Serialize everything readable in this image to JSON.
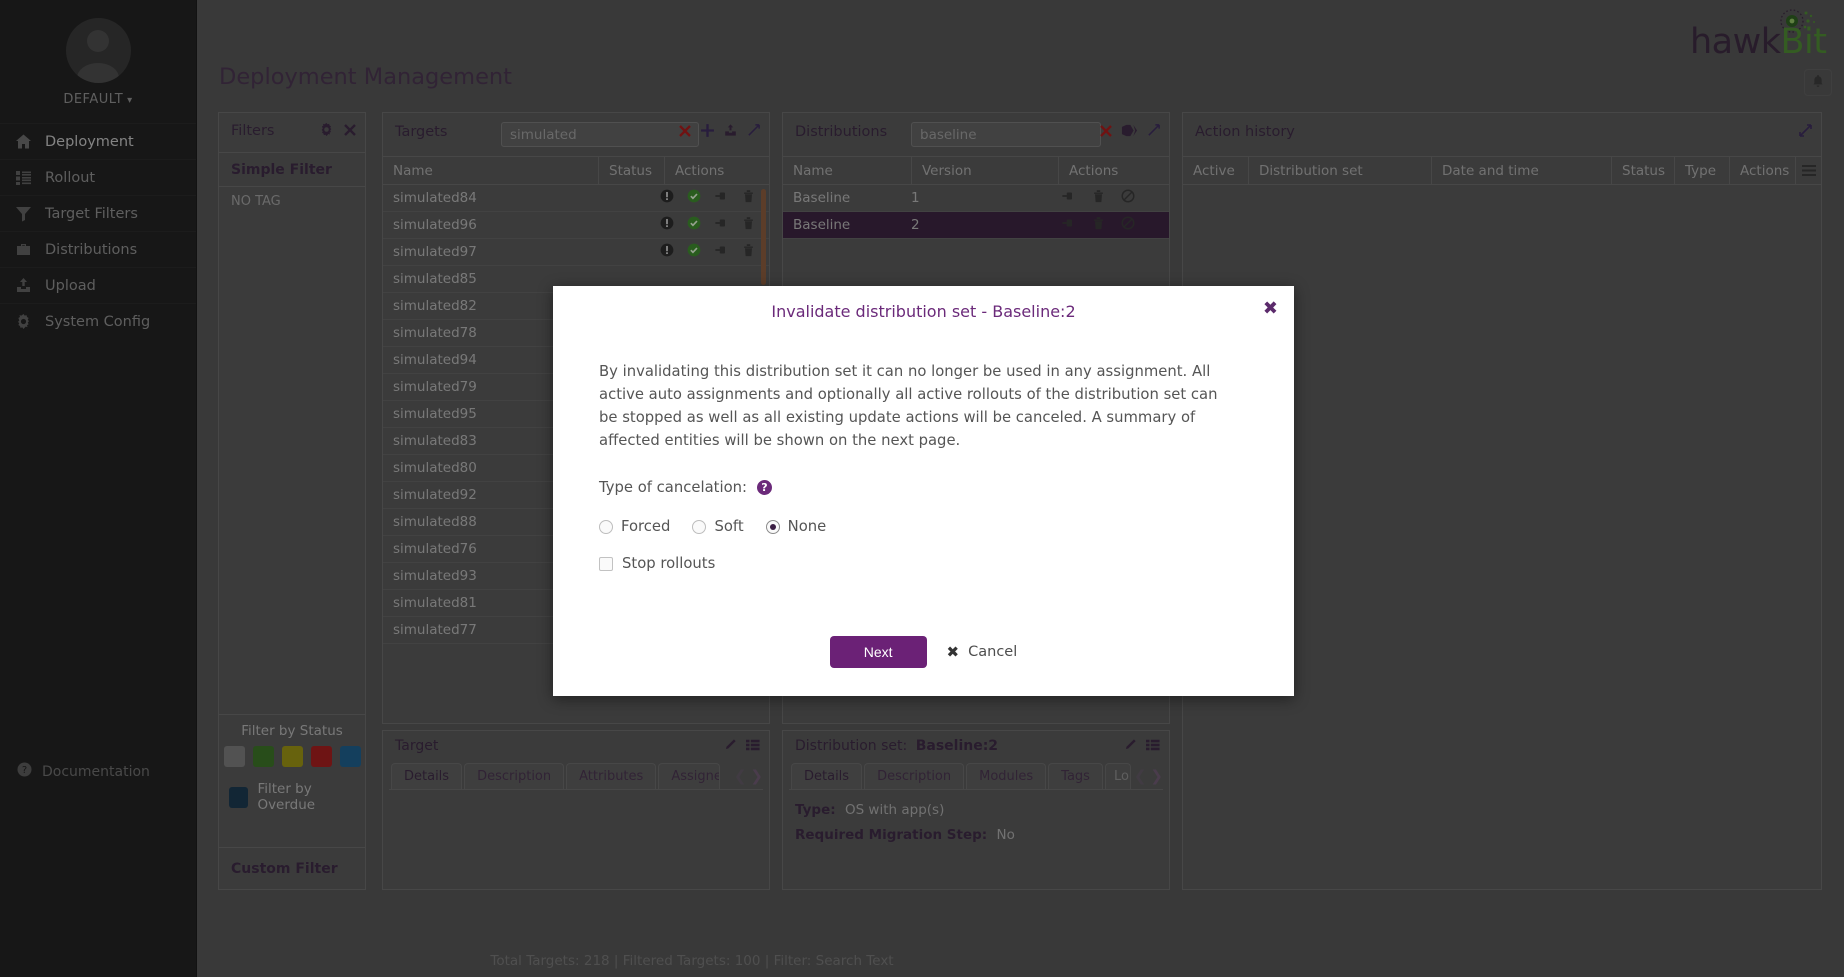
{
  "brand": {
    "name_part1": "hawk",
    "name_part2": "Bit",
    "color1": "#3d2a40",
    "color2": "#4e8a34"
  },
  "sidebar": {
    "tenant": "DEFAULT",
    "tenant_caret": "⌄",
    "items": [
      {
        "label": "Deployment",
        "icon": "home-icon",
        "active": true
      },
      {
        "label": "Rollout",
        "icon": "list-icon",
        "active": false
      },
      {
        "label": "Target Filters",
        "icon": "funnel-icon",
        "active": false
      },
      {
        "label": "Distributions",
        "icon": "briefcase-icon",
        "active": false
      },
      {
        "label": "Upload",
        "icon": "upload-icon",
        "active": false
      },
      {
        "label": "System Config",
        "icon": "gear-icon",
        "active": false
      }
    ],
    "documentation": "Documentation"
  },
  "header": {
    "title": "Deployment Management",
    "bell_icon": "bell-icon"
  },
  "filters_panel": {
    "title": "Filters",
    "gear_icon": "gear-icon",
    "close_icon": "close-icon",
    "simple_filter_label": "Simple Filter",
    "no_tag_label": "NO TAG",
    "filter_by_status_label": "Filter by Status",
    "status_colors": [
      "#7b7b7b",
      "#3c7328",
      "#9a9314",
      "#a41f1f",
      "#1f5f8b"
    ],
    "filter_by_overdue_label": "Filter by Overdue",
    "overdue_color": "#1b3a4f",
    "custom_filter_label": "Custom Filter"
  },
  "targets_panel": {
    "title": "Targets",
    "search_value": "simulated",
    "icons": [
      "close-icon",
      "plus-icon",
      "upload-icon",
      "maximize-icon"
    ],
    "columns": [
      "Name",
      "Status",
      "Actions"
    ],
    "rows": [
      {
        "name": "simulated84",
        "has_actions": true
      },
      {
        "name": "simulated96",
        "has_actions": true
      },
      {
        "name": "simulated97",
        "has_actions": true
      },
      {
        "name": "simulated85",
        "has_actions": false
      },
      {
        "name": "simulated82",
        "has_actions": false
      },
      {
        "name": "simulated78",
        "has_actions": false
      },
      {
        "name": "simulated94",
        "has_actions": false
      },
      {
        "name": "simulated79",
        "has_actions": false
      },
      {
        "name": "simulated95",
        "has_actions": false
      },
      {
        "name": "simulated83",
        "has_actions": false
      },
      {
        "name": "simulated80",
        "has_actions": false
      },
      {
        "name": "simulated92",
        "has_actions": false
      },
      {
        "name": "simulated88",
        "has_actions": false
      },
      {
        "name": "simulated76",
        "has_actions": false
      },
      {
        "name": "simulated93",
        "has_actions": false
      },
      {
        "name": "simulated81",
        "has_actions": false
      },
      {
        "name": "simulated77",
        "has_actions": true
      }
    ]
  },
  "distributions_panel": {
    "title": "Distributions",
    "search_value": "baseline",
    "icons": [
      "close-icon",
      "tags-icon",
      "maximize-icon"
    ],
    "columns": [
      "Name",
      "Version",
      "Actions"
    ],
    "rows": [
      {
        "name": "Baseline",
        "version": "1",
        "selected": false
      },
      {
        "name": "Baseline",
        "version": "2",
        "selected": true
      }
    ]
  },
  "action_history_panel": {
    "title": "Action history",
    "maximize_icon": "maximize-icon",
    "menu_icon": "hamburger-icon",
    "columns": [
      "Active",
      "Distribution set",
      "Date and time",
      "Status",
      "Type",
      "Actions"
    ]
  },
  "target_detail": {
    "title": "Target",
    "edit_icon": "pencil-icon",
    "list_icon": "list-icon",
    "tabs": [
      "Details",
      "Description",
      "Attributes",
      "Assigned"
    ],
    "active_tab": "Details",
    "prev_icon": "chevron-left-icon",
    "next_icon": "chevron-right-icon"
  },
  "distribution_detail": {
    "title_label": "Distribution set:",
    "title_value": "Baseline:2",
    "edit_icon": "pencil-icon",
    "list_icon": "list-icon",
    "tabs": [
      "Details",
      "Description",
      "Modules",
      "Tags",
      "Lo"
    ],
    "active_tab": "Details",
    "prev_icon": "chevron-left-icon",
    "next_icon": "chevron-right-icon",
    "fields": [
      {
        "key": "Type:",
        "value": "OS with app(s)"
      },
      {
        "key": "Required Migration Step:",
        "value": "No"
      }
    ]
  },
  "footer": {
    "status": "Total Targets: 218 | Filtered Targets: 100 | Filter: Search Text"
  },
  "modal": {
    "title": "Invalidate distribution set - Baseline:2",
    "close_icon": "close-icon",
    "description": "By invalidating this distribution set it can no longer be used in any assignment. All active auto assignments and optionally all active rollouts of the distribution set can be stopped as well as all existing update actions will be canceled. A summary of affected entities will be shown on the next page.",
    "cancelation_label": "Type of cancelation:",
    "help_icon": "help-icon",
    "help_glyph": "?",
    "radios": [
      {
        "label": "Forced",
        "selected": false
      },
      {
        "label": "Soft",
        "selected": false
      },
      {
        "label": "None",
        "selected": true
      }
    ],
    "checkbox": {
      "label": "Stop rollouts",
      "checked": false
    },
    "next_label": "Next",
    "cancel_label": "Cancel",
    "cancel_icon": "close-icon",
    "accent_color": "#6b2176"
  }
}
